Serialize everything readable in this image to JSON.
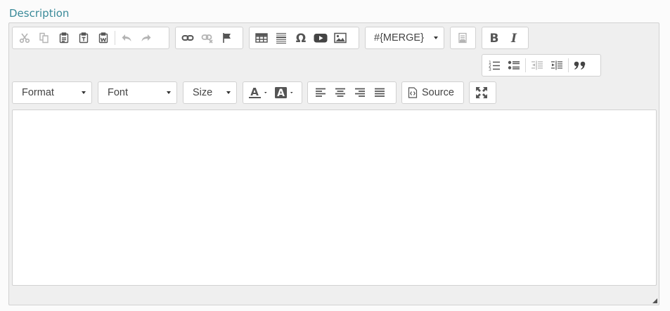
{
  "field": {
    "label": "Description"
  },
  "toolbar": {
    "merge_label": "#{MERGE}",
    "format_label": "Format",
    "font_label": "Font",
    "size_label": "Size",
    "source_label": "Source"
  },
  "colors": {
    "label": "#3a8a99",
    "icon_enabled": "#555555",
    "icon_disabled": "#b4b4b4"
  }
}
